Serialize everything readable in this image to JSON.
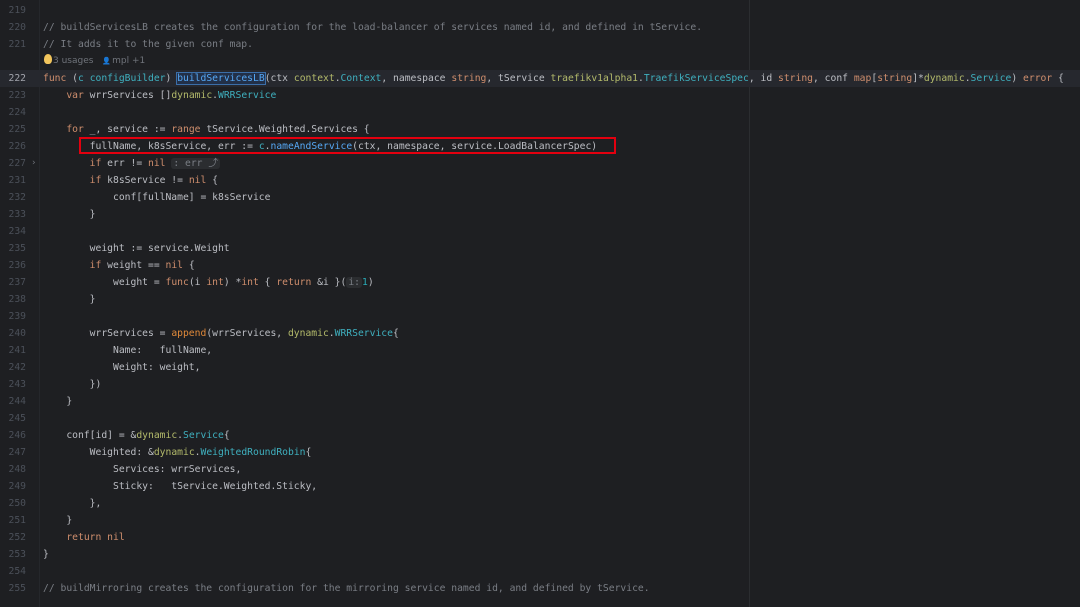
{
  "editor": {
    "language": "Go",
    "lens": {
      "usages": "3 usages",
      "author": "mpl +1"
    },
    "lines": [
      {
        "num": "219",
        "tokens": []
      },
      {
        "num": "220",
        "tokens": [
          [
            "// buildServicesLB creates the configuration for the load-balancer of services named id, and defined in tService.",
            "c"
          ]
        ]
      },
      {
        "num": "221",
        "tokens": [
          [
            "// It adds it to the given conf map.",
            "c"
          ]
        ]
      },
      {
        "lens": true
      },
      {
        "num": "222",
        "current": true,
        "tokens": [
          [
            "func ",
            "k"
          ],
          [
            "(",
            "d"
          ],
          [
            "c ",
            "t"
          ],
          [
            "configBuilder",
            "t"
          ],
          [
            ") ",
            "d"
          ],
          [
            "buildServicesLB",
            "f decl"
          ],
          [
            "(ctx ",
            "d"
          ],
          [
            "context",
            "p"
          ],
          [
            ".",
            "d"
          ],
          [
            "Context",
            "t"
          ],
          [
            ", namespace ",
            "d"
          ],
          [
            "string",
            "k"
          ],
          [
            ", tService ",
            "d"
          ],
          [
            "traefikv1alpha1",
            "p"
          ],
          [
            ".",
            "d"
          ],
          [
            "TraefikServiceSpec",
            "t"
          ],
          [
            ", id ",
            "d"
          ],
          [
            "string",
            "k"
          ],
          [
            ", conf ",
            "d"
          ],
          [
            "map",
            "k"
          ],
          [
            "[",
            "d"
          ],
          [
            "string",
            "k"
          ],
          [
            "]*",
            "d"
          ],
          [
            "dynamic",
            "p"
          ],
          [
            ".",
            "d"
          ],
          [
            "Service",
            "t"
          ],
          [
            ") ",
            "d"
          ],
          [
            "error",
            "k"
          ],
          [
            " {",
            "d"
          ]
        ]
      },
      {
        "num": "223",
        "tokens": [
          [
            "    var ",
            "k"
          ],
          [
            "wrrServices []",
            "d"
          ],
          [
            "dynamic",
            "p"
          ],
          [
            ".",
            "d"
          ],
          [
            "WRRService",
            "t"
          ]
        ]
      },
      {
        "num": "224",
        "tokens": []
      },
      {
        "num": "225",
        "tokens": [
          [
            "    for ",
            "k"
          ],
          [
            "_, service := ",
            "d"
          ],
          [
            "range ",
            "k"
          ],
          [
            "tService.Weighted.Services {",
            "d"
          ]
        ]
      },
      {
        "num": "226",
        "tokens": [
          [
            "        fullName, k8sService, err := ",
            "d"
          ],
          [
            "c",
            "t"
          ],
          [
            ".",
            "d"
          ],
          [
            "nameAndService",
            "f"
          ],
          [
            "(ctx, namespace, service.LoadBalancerSpec)",
            "d"
          ]
        ]
      },
      {
        "num": "227",
        "folded": true,
        "tokens": [
          [
            "        if ",
            "k"
          ],
          [
            "err != ",
            "d"
          ],
          [
            "nil",
            "k"
          ],
          [
            " ",
            "d"
          ],
          [
            ": err ⤴",
            "hint"
          ]
        ]
      },
      {
        "num": "231",
        "tokens": [
          [
            "        if ",
            "k"
          ],
          [
            "k8sService != ",
            "d"
          ],
          [
            "nil",
            "k"
          ],
          [
            " {",
            "d"
          ]
        ]
      },
      {
        "num": "232",
        "tokens": [
          [
            "            conf[fullName] = k8sService",
            "d"
          ]
        ]
      },
      {
        "num": "233",
        "tokens": [
          [
            "        }",
            "d"
          ]
        ]
      },
      {
        "num": "234",
        "tokens": []
      },
      {
        "num": "235",
        "tokens": [
          [
            "        weight := service.Weight",
            "d"
          ]
        ]
      },
      {
        "num": "236",
        "tokens": [
          [
            "        if ",
            "k"
          ],
          [
            "weight == ",
            "d"
          ],
          [
            "nil",
            "k"
          ],
          [
            " {",
            "d"
          ]
        ]
      },
      {
        "num": "237",
        "tokens": [
          [
            "            weight = ",
            "d"
          ],
          [
            "func",
            "k"
          ],
          [
            "(i ",
            "d"
          ],
          [
            "int",
            "k"
          ],
          [
            ") *",
            "d"
          ],
          [
            "int",
            "k"
          ],
          [
            " { ",
            "d"
          ],
          [
            "return ",
            "k"
          ],
          [
            "&i }(",
            "d"
          ],
          [
            "i:",
            "hint"
          ],
          [
            "1",
            "n"
          ],
          [
            ")",
            "d"
          ]
        ]
      },
      {
        "num": "238",
        "tokens": [
          [
            "        }",
            "d"
          ]
        ]
      },
      {
        "num": "239",
        "tokens": []
      },
      {
        "num": "240",
        "tokens": [
          [
            "        wrrServices = ",
            "d"
          ],
          [
            "append",
            "b"
          ],
          [
            "(wrrServices, ",
            "d"
          ],
          [
            "dynamic",
            "p"
          ],
          [
            ".",
            "d"
          ],
          [
            "WRRService",
            "t"
          ],
          [
            "{",
            "d"
          ]
        ]
      },
      {
        "num": "241",
        "tokens": [
          [
            "            Name:   fullName,",
            "d"
          ]
        ]
      },
      {
        "num": "242",
        "tokens": [
          [
            "            Weight: weight,",
            "d"
          ]
        ]
      },
      {
        "num": "243",
        "tokens": [
          [
            "        })",
            "d"
          ]
        ]
      },
      {
        "num": "244",
        "tokens": [
          [
            "    }",
            "d"
          ]
        ]
      },
      {
        "num": "245",
        "tokens": []
      },
      {
        "num": "246",
        "tokens": [
          [
            "    conf[id] = &",
            "d"
          ],
          [
            "dynamic",
            "p"
          ],
          [
            ".",
            "d"
          ],
          [
            "Service",
            "t"
          ],
          [
            "{",
            "d"
          ]
        ]
      },
      {
        "num": "247",
        "tokens": [
          [
            "        Weighted: &",
            "d"
          ],
          [
            "dynamic",
            "p"
          ],
          [
            ".",
            "d"
          ],
          [
            "WeightedRoundRobin",
            "t"
          ],
          [
            "{",
            "d"
          ]
        ]
      },
      {
        "num": "248",
        "tokens": [
          [
            "            Services: wrrServices,",
            "d"
          ]
        ]
      },
      {
        "num": "249",
        "tokens": [
          [
            "            Sticky:   tService.Weighted.Sticky,",
            "d"
          ]
        ]
      },
      {
        "num": "250",
        "tokens": [
          [
            "        },",
            "d"
          ]
        ]
      },
      {
        "num": "251",
        "tokens": [
          [
            "    }",
            "d"
          ]
        ]
      },
      {
        "num": "252",
        "tokens": [
          [
            "    return ",
            "k"
          ],
          [
            "nil",
            "k"
          ]
        ]
      },
      {
        "num": "253",
        "tokens": [
          [
            "}",
            "d"
          ]
        ]
      },
      {
        "num": "254",
        "tokens": []
      },
      {
        "num": "255",
        "tokens": [
          [
            "// buildMirroring creates the configuration for the mirroring service named id, and defined by tService.",
            "c"
          ]
        ]
      }
    ]
  },
  "highlight": {
    "line": "226",
    "color": "#e3000f"
  },
  "colors": {
    "background": "#1e1f22",
    "keyword": "#cf8e6d",
    "comment": "#7a7e85",
    "type": "#3fb0bf",
    "package": "#b3ba6b",
    "function": "#56a8f5"
  }
}
